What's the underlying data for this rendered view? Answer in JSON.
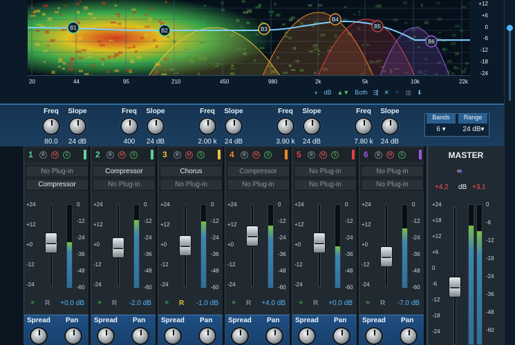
{
  "spectrum": {
    "freq_labels": [
      "20",
      "44",
      "95",
      "210",
      "450",
      "980",
      "2k",
      "5k",
      "10k",
      "22k"
    ],
    "db_labels": [
      "+12",
      "+6",
      "0",
      "-6",
      "-12",
      "-18",
      "-24"
    ],
    "band_markers": [
      {
        "label": "B1",
        "color": "#5fd0a0"
      },
      {
        "label": "B2",
        "color": "#5fd0a0"
      },
      {
        "label": "B3",
        "color": "#e8c23a"
      },
      {
        "label": "B4",
        "color": "#f08a2a"
      },
      {
        "label": "B5",
        "color": "#e04040"
      },
      {
        "label": "B6",
        "color": "#9a5ae0"
      }
    ],
    "toolbar": {
      "db": "dB",
      "both": "Both"
    }
  },
  "bands": [
    {
      "freq_label": "Freq",
      "slope_label": "Slope",
      "freq": "80.0",
      "slope": "24 dB"
    },
    {
      "freq_label": "Freq",
      "slope_label": "Slope",
      "freq": "400",
      "slope": "24 dB"
    },
    {
      "freq_label": "Freq",
      "slope_label": "Slope",
      "freq": "2.00 k",
      "slope": "24 dB"
    },
    {
      "freq_label": "Freq",
      "slope_label": "Slope",
      "freq": "3.90 k",
      "slope": "24 dB"
    },
    {
      "freq_label": "Freq",
      "slope_label": "Slope",
      "freq": "7.80 k",
      "slope": "24 dB"
    }
  ],
  "bands_box": {
    "bands_label": "Bands",
    "range_label": "Range",
    "bands_value": "6",
    "range_value": "24 dB"
  },
  "channels": [
    {
      "num": "1",
      "color": "#5fd0a0",
      "slot1": "No Plug-in",
      "slot1_on": false,
      "slot2": "Compressor",
      "slot2_on": true,
      "gain": "+0.0 dB",
      "fader": 0.45,
      "meter": 0.55,
      "rcolor": "#7f8a93"
    },
    {
      "num": "2",
      "color": "#5fd0a0",
      "slot1": "Compressor",
      "slot1_on": true,
      "slot2": "No Plug-in",
      "slot2_on": false,
      "gain": "-2.0 dB",
      "fader": 0.5,
      "meter": 0.82,
      "rcolor": "#7f8a93"
    },
    {
      "num": "3",
      "color": "#e8c23a",
      "slot1": "Chorus",
      "slot1_on": true,
      "slot2": "No Plug-in",
      "slot2_on": false,
      "gain": "-1.0 dB",
      "fader": 0.48,
      "meter": 0.8,
      "rcolor": "#e8c23a"
    },
    {
      "num": "4",
      "color": "#f08a2a",
      "slot1": "Compressor",
      "slot1_on": false,
      "slot2": "No Plug-in",
      "slot2_on": false,
      "gain": "+4.0 dB",
      "fader": 0.37,
      "meter": 0.75,
      "rcolor": "#7f8a93"
    },
    {
      "num": "5",
      "color": "#e04040",
      "slot1": "No Plug-in",
      "slot1_on": false,
      "slot2": "No Plug-in",
      "slot2_on": false,
      "gain": "+0.0 dB",
      "fader": 0.45,
      "meter": 0.5,
      "rcolor": "#7f8a93"
    },
    {
      "num": "6",
      "color": "#9a5ae0",
      "slot1": "No Plug-in",
      "slot1_on": false,
      "slot2": "No Plug-in",
      "slot2_on": false,
      "gain": "-7.0 dB",
      "fader": 0.6,
      "meter": 0.72,
      "rcolor": "#7f8a93"
    }
  ],
  "channel_buttons": [
    "B",
    "M",
    "S"
  ],
  "fader_scale": [
    "+24",
    "+12",
    "+0",
    "-12",
    "-24"
  ],
  "meter_scale": [
    "0",
    "-12",
    "-24",
    "-36",
    "-48",
    "-60"
  ],
  "r_label": "R",
  "spread_label": "Spread",
  "pan_label": "Pan",
  "master": {
    "title": "MASTER",
    "left_peak": "+4.2",
    "db": "dB",
    "right_peak": "+3.1",
    "scale": [
      "+24",
      "+18",
      "+12",
      "+6",
      "0",
      "-6",
      "-12",
      "-18",
      "-24"
    ],
    "meter_scale": [
      "0",
      "-6",
      "-12",
      "-18",
      "-24",
      "-36",
      "-48",
      "-60"
    ],
    "fader": 0.6,
    "meter": 0.85
  }
}
